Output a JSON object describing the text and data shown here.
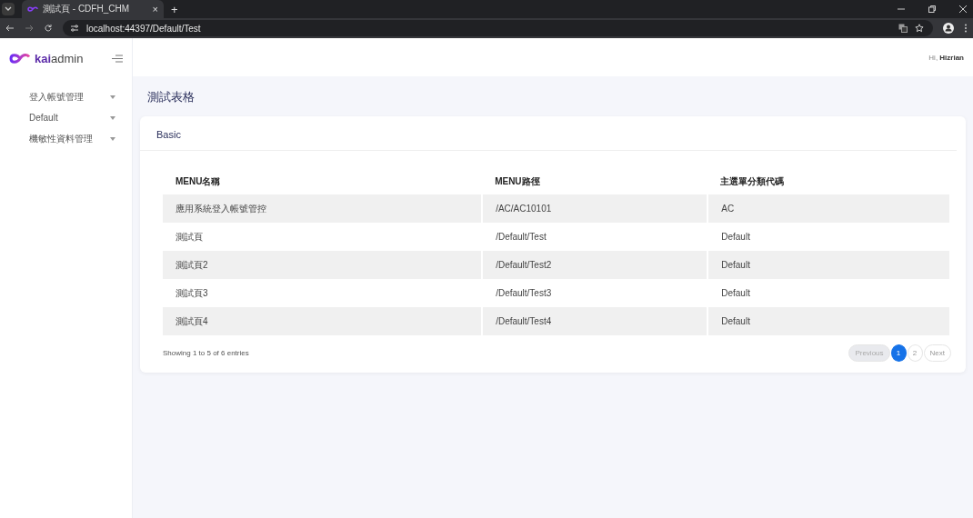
{
  "browser": {
    "tab_title": "測試頁 - CDFH_CHM",
    "tab_close": "×",
    "new_tab": "+",
    "url": "localhost:44397/Default/Test"
  },
  "sidebar": {
    "logo_bold": "kai",
    "logo_light": "admin",
    "items": [
      {
        "label": "登入帳號管理",
        "expanded": false
      },
      {
        "label": "Default",
        "expanded": false
      },
      {
        "label": "機敏性資料管理",
        "expanded": false
      }
    ]
  },
  "header": {
    "greeting": "Hi,",
    "user": "Hizrian"
  },
  "page_title": "測試表格",
  "card": {
    "title": "Basic"
  },
  "table": {
    "columns": [
      "MENU名稱",
      "MENU路徑",
      "主選單分類代碼"
    ],
    "rows": [
      [
        "應用系統登入帳號管控",
        "/AC/AC10101",
        "AC"
      ],
      [
        "測試頁",
        "/Default/Test",
        "Default"
      ],
      [
        "測試頁2",
        "/Default/Test2",
        "Default"
      ],
      [
        "測試頁3",
        "/Default/Test3",
        "Default"
      ],
      [
        "測試頁4",
        "/Default/Test4",
        "Default"
      ]
    ]
  },
  "footer": {
    "info": "Showing 1 to 5 of 6 entries"
  },
  "pagination": [
    {
      "label": "Previous",
      "kind": "nav",
      "disabled": true,
      "selected": false
    },
    {
      "label": "1",
      "kind": "page",
      "disabled": false,
      "selected": true
    },
    {
      "label": "2",
      "kind": "page",
      "disabled": false,
      "selected": false
    },
    {
      "label": "Next",
      "kind": "nav",
      "disabled": false,
      "selected": false
    }
  ]
}
